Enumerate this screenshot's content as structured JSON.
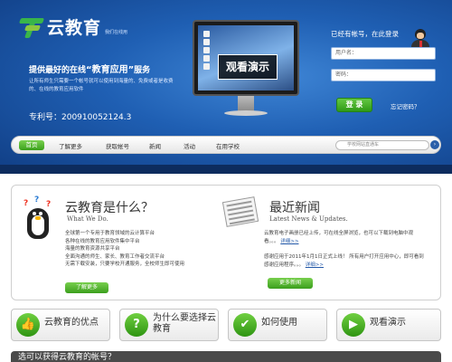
{
  "brand": {
    "name": "云教育",
    "tagline": "我们在线用"
  },
  "hero": {
    "slogan_prefix": "提供最好的在线",
    "slogan_highlight": "“教育应用”",
    "slogan_suffix": "服务",
    "intro": "让所有师生只需要一个帐号就可以使用到海量的、免费或者是收费的、在线的教育应用软件",
    "patent": "专利号：200910052124.3",
    "demo_label": "观看演示"
  },
  "login": {
    "title": "已经有帐号，在此登录",
    "username_label": "用户名：",
    "password_label": "密码：",
    "submit": "登 录",
    "forgot": "忘记密码？"
  },
  "nav": {
    "items": [
      "首页",
      "了解更多",
      "获取帐号",
      "新闻",
      "活动",
      "在用学校"
    ],
    "search_placeholder": "学校网站直通车"
  },
  "about": {
    "title": "云教育是什么？",
    "subtitle": "What We Do.",
    "lines": [
      "全球第一个专用于教育领域的云计算平台",
      "各种在线的教育应用软件集中平台",
      "海量的教育资源共享平台",
      "全面沟通的师生、家长、教育工作者交流平台",
      "无需下载安装，只要学校开通服务，全校师生即可使用"
    ],
    "more": "了解更多"
  },
  "news": {
    "title": "最近新闻",
    "subtitle": "Latest News & Updates.",
    "item1": "云教育电子画册已经上传，可在线全屏浏览，也可以下载到电脑中观看。。。",
    "item2": "感谢应用于2011年1月1日正式上线！  所有用户打开应用中心，即可看到感谢应用程序。。。",
    "detail": "详细>>",
    "more": "更多新闻"
  },
  "features": [
    {
      "label": "云教育的优点",
      "icon": "thumbs-up-icon",
      "glyph": "👍"
    },
    {
      "label": "为什么要选择云教育",
      "icon": "question-icon",
      "glyph": "?"
    },
    {
      "label": "如何使用",
      "icon": "check-icon",
      "glyph": "✔"
    },
    {
      "label": "观看演示",
      "icon": "play-icon",
      "glyph": "▶"
    }
  ],
  "bottom_bar": "选可以获得云教育的帐号？",
  "colors": {
    "hero_blue": "#1f5fb3",
    "accent_green": "#3aa01c",
    "link_blue": "#2358a8"
  }
}
